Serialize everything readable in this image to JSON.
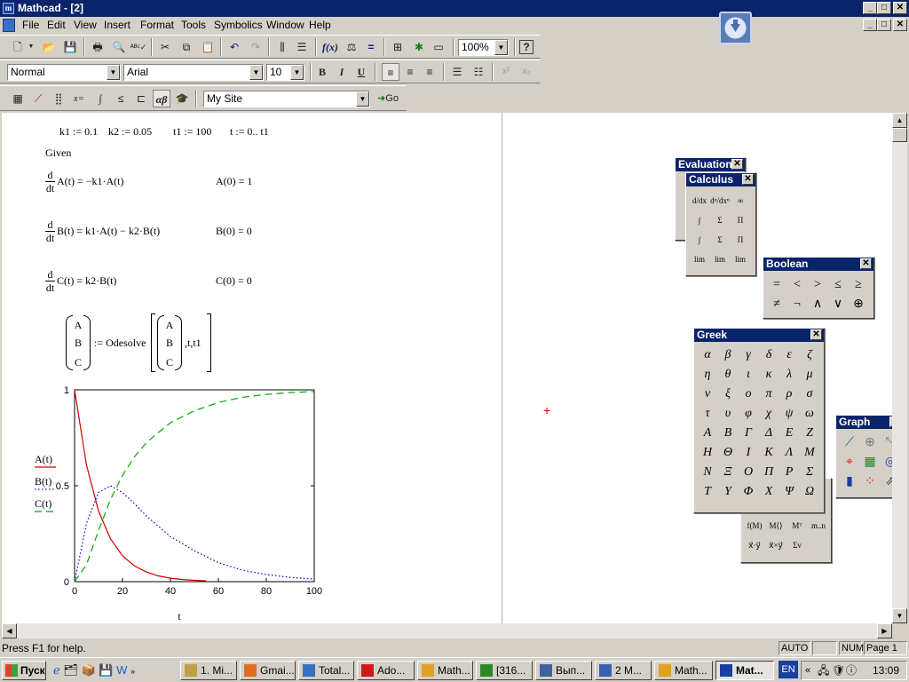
{
  "window": {
    "title": "Mathcad - [2]",
    "app_icon": "m",
    "min": "_",
    "max": "□",
    "close": "✕"
  },
  "menu": [
    "File",
    "Edit",
    "View",
    "Insert",
    "Format",
    "Tools",
    "Symbolics",
    "Window",
    "Help"
  ],
  "toolbar_standard": {
    "icons": [
      "new-icon",
      "open-icon",
      "save-icon",
      "print-icon",
      "print-preview-icon",
      "spell-check-icon",
      "cut-icon",
      "copy-icon",
      "paste-icon",
      "undo-icon",
      "redo-icon",
      "align-across-icon",
      "align-down-icon",
      "insert-function-icon",
      "insert-unit-icon",
      "calculate-icon",
      "insert-component-icon",
      "resources-icon",
      "calculate-worksheet-icon",
      "help-icon"
    ],
    "zoom": "100%",
    "help": "?"
  },
  "toolbar_format": {
    "style": "Normal",
    "font": "Arial",
    "size": "10",
    "bold": "B",
    "italic": "I",
    "underline": "U"
  },
  "toolbar_math": {
    "site": "My Site",
    "go": "Go",
    "icons": [
      "calculator-icon",
      "graph-icon",
      "matrix-icon",
      "evaluation-icon",
      "calculus-icon",
      "boolean-icon",
      "programming-icon",
      "greek-icon",
      "symbolic-icon"
    ]
  },
  "worksheet": {
    "defs": {
      "k1": "k1 := 0.1",
      "k2": "k2 := 0.05",
      "t1": "t1 := 100",
      "t": "t := 0.. t1"
    },
    "given": "Given",
    "d": "d",
    "dt": "dt",
    "eq1": "A(t) = −k1·A(t)",
    "ic1": "A(0) = 1",
    "eq2": "B(t) = k1·A(t) − k2·B(t)",
    "ic2": "B(0) = 0",
    "eq3": "C(t) = k2·B(t)",
    "ic3": "C(0) = 0",
    "vec": [
      "A",
      "B",
      "C"
    ],
    "odesolve": ":= Odesolve",
    "odesolve_args": ",t,t1",
    "cursor": "+"
  },
  "chart_data": {
    "type": "line",
    "title": "",
    "xlabel": "t",
    "ylabel": "",
    "xlim": [
      0,
      100
    ],
    "ylim": [
      0,
      1
    ],
    "xticks": [
      "0",
      "20",
      "40",
      "60",
      "80",
      "100"
    ],
    "yticks": [
      "0",
      "0.5",
      "1"
    ],
    "legend": [
      "A(t)",
      "B(t)",
      "C(t)"
    ],
    "series": [
      {
        "name": "A(t)",
        "color": "#cc0000",
        "style": "solid",
        "x": [
          0,
          5,
          10,
          15,
          20,
          25,
          30,
          35,
          40,
          45,
          50,
          55
        ],
        "y": [
          1.0,
          0.607,
          0.368,
          0.223,
          0.135,
          0.082,
          0.05,
          0.03,
          0.018,
          0.011,
          0.007,
          0.004
        ]
      },
      {
        "name": "B(t)",
        "color": "#0000cc",
        "style": "dotted",
        "x": [
          0,
          5,
          10,
          15,
          20,
          25,
          30,
          40,
          50,
          60,
          70,
          80,
          90,
          100
        ],
        "y": [
          0,
          0.304,
          0.465,
          0.5,
          0.465,
          0.406,
          0.342,
          0.235,
          0.161,
          0.099,
          0.06,
          0.037,
          0.022,
          0.013
        ]
      },
      {
        "name": "C(t)",
        "color": "#00aa00",
        "style": "dashed",
        "x": [
          0,
          5,
          10,
          15,
          20,
          25,
          30,
          40,
          50,
          60,
          70,
          80,
          90,
          100
        ],
        "y": [
          0,
          0.089,
          0.267,
          0.428,
          0.554,
          0.651,
          0.725,
          0.829,
          0.891,
          0.934,
          0.961,
          0.976,
          0.986,
          0.991
        ]
      }
    ]
  },
  "palettes": {
    "evaluation": {
      "title": "Evaluation",
      "close": "✕"
    },
    "calculus": {
      "title": "Calculus",
      "close": "✕",
      "items": [
        "d/dx",
        "dⁿ/dxⁿ",
        "∞",
        "∫",
        "Σ",
        "Π",
        "∫",
        "Σ",
        "Π",
        "lim",
        "lim",
        "lim"
      ]
    },
    "boolean": {
      "title": "Boolean",
      "close": "✕",
      "items": [
        "=",
        "<",
        ">",
        "≤",
        "≥",
        "≠",
        "¬",
        "∧",
        "∨",
        "⊕"
      ]
    },
    "greek": {
      "title": "Greek",
      "close": "✕",
      "items": [
        "α",
        "β",
        "γ",
        "δ",
        "ε",
        "ζ",
        "η",
        "θ",
        "ι",
        "κ",
        "λ",
        "μ",
        "ν",
        "ξ",
        "ο",
        "π",
        "ρ",
        "σ",
        "τ",
        "υ",
        "φ",
        "χ",
        "ψ",
        "ω",
        "Α",
        "Β",
        "Γ",
        "Δ",
        "Ε",
        "Ζ",
        "Η",
        "Θ",
        "Ι",
        "Κ",
        "Λ",
        "Μ",
        "Ν",
        "Ξ",
        "Ο",
        "Π",
        "Ρ",
        "Σ",
        "Τ",
        "Υ",
        "Φ",
        "Χ",
        "Ψ",
        "Ω"
      ]
    },
    "graph": {
      "title": "Graph",
      "close": "✕",
      "icons": [
        "xy-plot-icon",
        "polar-plot-icon",
        "zoom-icon",
        "trace-icon",
        "surface-plot-icon",
        "contour-plot-icon",
        "bar-plot-icon",
        "scatter-plot-icon",
        "vector-field-icon"
      ]
    },
    "matrix_partial": {
      "items": [
        "f(M)",
        "M⟨⟩",
        "Mᵀ",
        "m..n",
        "x⃗·y⃗",
        "x⃗×y⃗",
        "Σv"
      ]
    }
  },
  "status": {
    "help": "Press F1 for help.",
    "auto": "AUTO",
    "num": "NUM",
    "page": "Page 1"
  },
  "taskbar": {
    "start": "Пуск",
    "tasks": [
      "1. Mi...",
      "Gmai...",
      "Total...",
      "Ado...",
      "Math...",
      "[316...",
      "Вып...",
      "2 M...",
      "Math...",
      "Mat..."
    ],
    "lang": "EN",
    "time": "13:09"
  }
}
